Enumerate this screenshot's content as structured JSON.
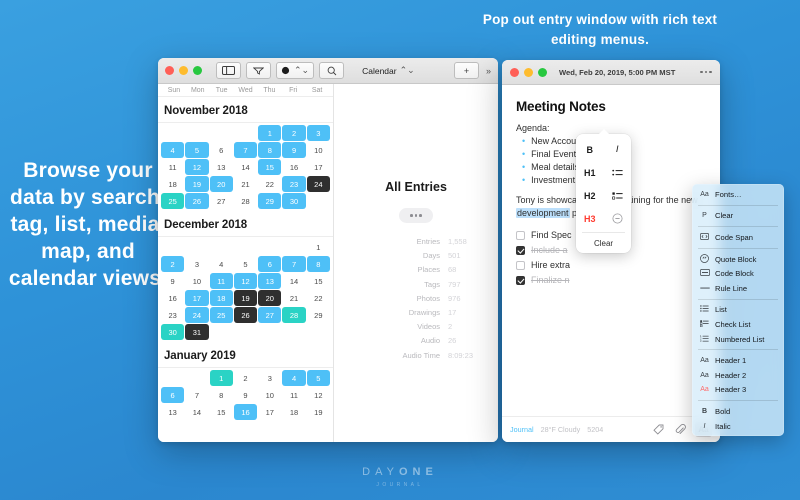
{
  "promo": {
    "left": "Browse your data by search, tag, list, media, map, and calendar views.",
    "top": "Pop out entry window with rich text editing menus."
  },
  "brand": {
    "day": "DAY",
    "one": "ONE",
    "sub": "JOURNAL"
  },
  "app_window": {
    "toolbar": {
      "sidebar_toggle": "sidebar-icon",
      "filter": "filter-icon",
      "color_swatch": "color-swatch",
      "search": "search-icon",
      "view_label": "Calendar",
      "add": "+",
      "overflow": "»"
    },
    "calendar": {
      "weekdays": [
        "Sun",
        "Mon",
        "Tue",
        "Wed",
        "Thu",
        "Fri",
        "Sat"
      ],
      "months": [
        {
          "title": "November 2018",
          "lead_blanks": 4,
          "days": [
            {
              "n": 1,
              "state": "blue"
            },
            {
              "n": 2,
              "state": "blue"
            },
            {
              "n": 3,
              "state": "blue"
            },
            {
              "n": 4,
              "state": "blue"
            },
            {
              "n": 5,
              "state": "blue"
            },
            {
              "n": 6,
              "state": "none"
            },
            {
              "n": 7,
              "state": "blue"
            },
            {
              "n": 8,
              "state": "blue"
            },
            {
              "n": 9,
              "state": "blue"
            },
            {
              "n": 10,
              "state": "none"
            },
            {
              "n": 11,
              "state": "none"
            },
            {
              "n": 12,
              "state": "blue"
            },
            {
              "n": 13,
              "state": "none"
            },
            {
              "n": 14,
              "state": "none"
            },
            {
              "n": 15,
              "state": "blue"
            },
            {
              "n": 16,
              "state": "none"
            },
            {
              "n": 17,
              "state": "none"
            },
            {
              "n": 18,
              "state": "none"
            },
            {
              "n": 19,
              "state": "blue"
            },
            {
              "n": 20,
              "state": "blue"
            },
            {
              "n": 21,
              "state": "none"
            },
            {
              "n": 22,
              "state": "none"
            },
            {
              "n": 23,
              "state": "blue"
            },
            {
              "n": 24,
              "state": "dark"
            },
            {
              "n": 25,
              "state": "teal"
            },
            {
              "n": 26,
              "state": "blue"
            },
            {
              "n": 27,
              "state": "none"
            },
            {
              "n": 28,
              "state": "none"
            },
            {
              "n": 29,
              "state": "blue"
            },
            {
              "n": 30,
              "state": "blue"
            }
          ]
        },
        {
          "title": "December 2018",
          "lead_blanks": 6,
          "days": [
            {
              "n": 1,
              "state": "none"
            },
            {
              "n": 2,
              "state": "blue"
            },
            {
              "n": 3,
              "state": "none"
            },
            {
              "n": 4,
              "state": "none"
            },
            {
              "n": 5,
              "state": "none"
            },
            {
              "n": 6,
              "state": "blue"
            },
            {
              "n": 7,
              "state": "blue"
            },
            {
              "n": 8,
              "state": "blue"
            },
            {
              "n": 9,
              "state": "none"
            },
            {
              "n": 10,
              "state": "none"
            },
            {
              "n": 11,
              "state": "blue"
            },
            {
              "n": 12,
              "state": "blue"
            },
            {
              "n": 13,
              "state": "blue"
            },
            {
              "n": 14,
              "state": "none"
            },
            {
              "n": 15,
              "state": "none"
            },
            {
              "n": 16,
              "state": "none"
            },
            {
              "n": 17,
              "state": "blue"
            },
            {
              "n": 18,
              "state": "blue"
            },
            {
              "n": 19,
              "state": "dark"
            },
            {
              "n": 20,
              "state": "dark"
            },
            {
              "n": 21,
              "state": "none"
            },
            {
              "n": 22,
              "state": "none"
            },
            {
              "n": 23,
              "state": "none"
            },
            {
              "n": 24,
              "state": "blue"
            },
            {
              "n": 25,
              "state": "blue"
            },
            {
              "n": 26,
              "state": "dark"
            },
            {
              "n": 27,
              "state": "blue"
            },
            {
              "n": 28,
              "state": "teal"
            },
            {
              "n": 29,
              "state": "none"
            },
            {
              "n": 30,
              "state": "teal"
            },
            {
              "n": 31,
              "state": "dark"
            }
          ]
        },
        {
          "title": "January 2019",
          "lead_blanks": 2,
          "days": [
            {
              "n": 1,
              "state": "teal"
            },
            {
              "n": 2,
              "state": "none"
            },
            {
              "n": 3,
              "state": "none"
            },
            {
              "n": 4,
              "state": "blue"
            },
            {
              "n": 5,
              "state": "blue"
            },
            {
              "n": 6,
              "state": "blue"
            },
            {
              "n": 7,
              "state": "none"
            },
            {
              "n": 8,
              "state": "none"
            },
            {
              "n": 9,
              "state": "none"
            },
            {
              "n": 10,
              "state": "none"
            },
            {
              "n": 11,
              "state": "none"
            },
            {
              "n": 12,
              "state": "none"
            },
            {
              "n": 13,
              "state": "none"
            },
            {
              "n": 14,
              "state": "none"
            },
            {
              "n": 15,
              "state": "none"
            },
            {
              "n": 16,
              "state": "blue"
            },
            {
              "n": 17,
              "state": "none"
            },
            {
              "n": 18,
              "state": "none"
            },
            {
              "n": 19,
              "state": "none"
            }
          ]
        }
      ]
    },
    "entries_panel": {
      "title": "All Entries",
      "stats": [
        {
          "label": "Entries",
          "value": "1,558"
        },
        {
          "label": "Days",
          "value": "501"
        },
        {
          "label": "Places",
          "value": "68"
        },
        {
          "label": "Tags",
          "value": "797"
        },
        {
          "label": "Photos",
          "value": "976"
        },
        {
          "label": "Drawings",
          "value": "17"
        },
        {
          "label": "Videos",
          "value": "2"
        },
        {
          "label": "Audio",
          "value": "26"
        },
        {
          "label": "Audio Time",
          "value": "8:09:23"
        }
      ]
    }
  },
  "entry_window": {
    "date": "Wed, Feb 20, 2019, 5:00 PM MST",
    "heading": "Meeting Notes",
    "agenda_label": "Agenda:",
    "agenda_items": [
      "New Accounts",
      "Final Event count",
      "Meal details",
      "Investment group"
    ],
    "paragraph": {
      "before": "Tony is showcasing the remaining for the new ",
      "highlight": "development",
      "after": " project."
    },
    "checklist": [
      {
        "text": "Find Spec",
        "done": false
      },
      {
        "text": "Include a",
        "done": true
      },
      {
        "text": "Hire extra",
        "done": false
      },
      {
        "text": "Finalize n",
        "done": true
      }
    ],
    "footer": {
      "journal": "Journal",
      "weather": "28°F Cloudy",
      "count": "5204",
      "tag_icon": "tag-icon",
      "attach_icon": "paperclip-icon",
      "format_label": "Aa"
    }
  },
  "format_popover": {
    "bold": "B",
    "italic": "I",
    "h1": "H1",
    "h2": "H2",
    "h3": "H3",
    "clear": "Clear"
  },
  "rich_menu": {
    "groups": [
      [
        {
          "icon": "Aa",
          "label": "Fonts…"
        }
      ],
      [
        {
          "icon": "P",
          "label": "Clear"
        }
      ],
      [
        {
          "icon": "code-span-icon",
          "label": "Code Span"
        }
      ],
      [
        {
          "icon": "quote-block-icon",
          "label": "Quote Block"
        },
        {
          "icon": "code-block-icon",
          "label": "Code Block"
        },
        {
          "icon": "rule-line-icon",
          "label": "Rule Line"
        }
      ],
      [
        {
          "icon": "list-icon",
          "label": "List"
        },
        {
          "icon": "check-list-icon",
          "label": "Check List"
        },
        {
          "icon": "numbered-list-icon",
          "label": "Numbered List"
        }
      ],
      [
        {
          "icon": "Aa",
          "label": "Header 1"
        },
        {
          "icon": "Aa",
          "label": "Header 2"
        },
        {
          "icon": "Aa",
          "label": "Header 3",
          "red": true
        }
      ],
      [
        {
          "icon": "B",
          "label": "Bold"
        },
        {
          "icon": "I",
          "label": "Italic"
        }
      ]
    ]
  },
  "colors": {
    "background": "#2e92d8",
    "day_blue": "#4ec0f7",
    "day_teal": "#2ad3c5",
    "day_dark": "#2f2f2f",
    "highlight": "#bcdffb",
    "accent_red": "#ff3b30"
  }
}
